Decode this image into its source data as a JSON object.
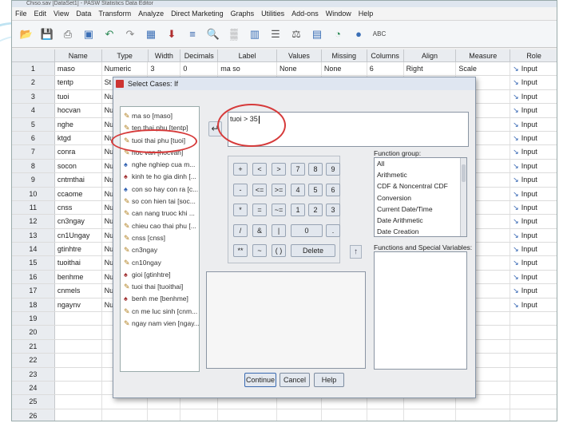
{
  "window_title": "Chiso.sav [DataSet1] - PASW Statistics Data Editor",
  "menu": [
    "File",
    "Edit",
    "View",
    "Data",
    "Transform",
    "Analyze",
    "Direct Marketing",
    "Graphs",
    "Utilities",
    "Add-ons",
    "Window",
    "Help"
  ],
  "columns": [
    "Name",
    "Type",
    "Width",
    "Decimals",
    "Label",
    "Values",
    "Missing",
    "Columns",
    "Align",
    "Measure",
    "Role"
  ],
  "rows": [
    {
      "n": "1",
      "name": "maso",
      "type": "Numeric",
      "width": "3",
      "dec": "0",
      "label": "ma so",
      "values": "None",
      "missing": "None",
      "cols": "6",
      "align": "Right",
      "measure": "Scale",
      "role": "Input"
    },
    {
      "n": "2",
      "name": "tentp",
      "type": "St",
      "measure": "",
      "role": "Input"
    },
    {
      "n": "3",
      "name": "tuoi",
      "type": "Nu",
      "measure": "",
      "role": "Input"
    },
    {
      "n": "4",
      "name": "hocvan",
      "type": "Nu",
      "measure": "al",
      "role": "Input"
    },
    {
      "n": "5",
      "name": "nghe",
      "type": "Nu",
      "measure": "al",
      "role": "Input"
    },
    {
      "n": "6",
      "name": "ktgd",
      "type": "Nu",
      "measure": "al",
      "role": "Input"
    },
    {
      "n": "7",
      "name": "conra",
      "type": "Nu",
      "measure": "",
      "role": "Input"
    },
    {
      "n": "8",
      "name": "socon",
      "type": "Nu",
      "measure": "",
      "role": "Input"
    },
    {
      "n": "9",
      "name": "cntmthai",
      "type": "Nu",
      "measure": "",
      "role": "Input"
    },
    {
      "n": "10",
      "name": "ccaome",
      "type": "Nu",
      "measure": "",
      "role": "Input"
    },
    {
      "n": "11",
      "name": "cnss",
      "type": "Nu",
      "measure": "",
      "role": "Input"
    },
    {
      "n": "12",
      "name": "cn3ngay",
      "type": "Nu",
      "measure": "",
      "role": "Input"
    },
    {
      "n": "13",
      "name": "cn1Ungay",
      "type": "Nu",
      "measure": "",
      "role": "Input"
    },
    {
      "n": "14",
      "name": "gtinhtre",
      "type": "Nu",
      "measure": "al",
      "role": "Input"
    },
    {
      "n": "15",
      "name": "tuoithai",
      "type": "Nu",
      "measure": "",
      "role": "Input"
    },
    {
      "n": "16",
      "name": "benhme",
      "type": "Nu",
      "measure": "al",
      "role": "Input"
    },
    {
      "n": "17",
      "name": "cnmels",
      "type": "Nu",
      "measure": "",
      "role": "Input"
    },
    {
      "n": "18",
      "name": "ngaynv",
      "type": "Nu",
      "measure": "",
      "role": "Input"
    },
    {
      "n": "19"
    },
    {
      "n": "20"
    },
    {
      "n": "21"
    },
    {
      "n": "22"
    },
    {
      "n": "23"
    },
    {
      "n": "24"
    },
    {
      "n": "25"
    },
    {
      "n": "26"
    }
  ],
  "dialog": {
    "title": "Select Cases: If",
    "expression": "tuoi > 35",
    "variables": [
      {
        "label": "ma so [maso]",
        "kind": "scale"
      },
      {
        "label": "ten thai phu [tentp]",
        "kind": "scale"
      },
      {
        "label": "tuoi thai phu [tuoi]",
        "kind": "scale"
      },
      {
        "label": "hoc van [hocvan]",
        "kind": "scale"
      },
      {
        "label": "nghe nghiep cua m...",
        "kind": "ordinal"
      },
      {
        "label": "kinh te ho gia dinh [...",
        "kind": "nominal"
      },
      {
        "label": "con so hay con ra [c...",
        "kind": "ordinal"
      },
      {
        "label": "so con hien tai [soc...",
        "kind": "scale"
      },
      {
        "label": "can nang truoc khi ...",
        "kind": "scale"
      },
      {
        "label": "chieu cao thai phu [...",
        "kind": "scale"
      },
      {
        "label": "cnss [cnss]",
        "kind": "scale"
      },
      {
        "label": "cn3ngay",
        "kind": "scale"
      },
      {
        "label": "cn10ngay",
        "kind": "scale"
      },
      {
        "label": "gioi [gtinhtre]",
        "kind": "nominal"
      },
      {
        "label": "tuoi thai [tuoithai]",
        "kind": "scale"
      },
      {
        "label": "benh me [benhme]",
        "kind": "nominal"
      },
      {
        "label": "cn me luc sinh [cnm...",
        "kind": "scale"
      },
      {
        "label": "ngay nam vien [ngay...",
        "kind": "scale"
      }
    ],
    "keypad": [
      "+",
      "<",
      ">",
      "7",
      "8",
      "9",
      "-",
      "<=",
      ">=",
      "4",
      "5",
      "6",
      "*",
      "=",
      "~=",
      "1",
      "2",
      "3",
      "/",
      "&",
      "|",
      "0",
      ".",
      "**",
      "~",
      "( )",
      "Delete"
    ],
    "function_group_label": "Function group:",
    "function_groups": [
      "All",
      "Arithmetic",
      "CDF & Noncentral CDF",
      "Conversion",
      "Current Date/Time",
      "Date Arithmetic",
      "Date Creation"
    ],
    "functions_label": "Functions and Special Variables:",
    "buttons": {
      "continue": "Continue",
      "cancel": "Cancel",
      "help": "Help"
    }
  }
}
